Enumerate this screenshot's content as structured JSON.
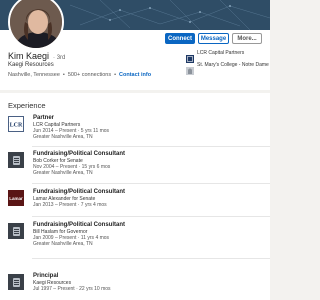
{
  "profile": {
    "name": "Kim Kaegi",
    "degree": "· 3rd",
    "headline": "Kaegi Resources",
    "location": "Nashville, Tennessee",
    "connections": "500+ connections",
    "contact_info": "Contact info"
  },
  "actions": {
    "connect": "Connect",
    "message": "Message",
    "more": "More..."
  },
  "side": {
    "items": [
      {
        "label": "LCR Capital Partners",
        "icon": "lcr-logo"
      },
      {
        "label": "St. Mary's College - Notre Dame",
        "icon": "school-logo"
      }
    ]
  },
  "experience": {
    "title": "Experience",
    "jobs": [
      {
        "title": "Partner",
        "company": "LCR Capital Partners",
        "dates": "Jun 2014 – Present · 5 yrs 11 mos",
        "location": "Greater Nashville Area, TN",
        "logo": "lcr"
      },
      {
        "title": "Fundraising/Political Consultant",
        "company": "Bob Corker for Senate",
        "dates": "Nov 2004 – Present · 15 yrs 6 mos",
        "location": "Greater Nashville Area, TN",
        "logo": "generic"
      },
      {
        "title": "Fundraising/Political Consultant",
        "company": "Lamar Alexander for Senate",
        "dates": "Jan 2013 – Present · 7 yrs 4 mos",
        "location": "Greater Nashville Area, TN",
        "logo": "lamar"
      },
      {
        "title": "Fundraising/Political Consultant",
        "company": "Bill Haslam for Governor",
        "dates": "Jan 2009 – Present · 11 yrs 4 mos",
        "location": "Greater Nashville Area, TN",
        "logo": "generic"
      },
      {
        "title": "Principal",
        "company": "Kaegi Resources",
        "dates": "Jul 1997 – Present · 22 yrs 10 mos",
        "location": "",
        "logo": "generic"
      }
    ]
  },
  "colors": {
    "brand": "#0a66c2",
    "banner": "#2f4d66"
  },
  "logos": {
    "lcr_text": "LCR",
    "lamar_text": "Lamar"
  }
}
